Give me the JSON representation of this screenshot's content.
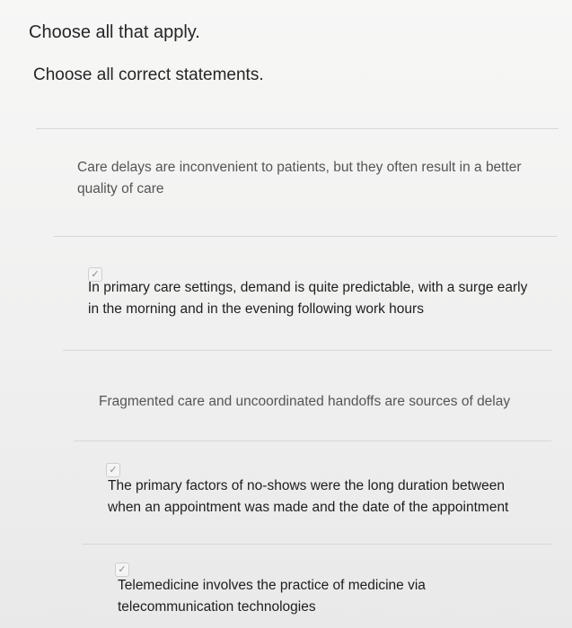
{
  "question": {
    "instruction": "Choose all that apply.",
    "prompt": "Choose all correct statements."
  },
  "options": [
    {
      "text": "Care delays are inconvenient to patients, but they often result in a better quality of care",
      "checked": false
    },
    {
      "text": "In primary care settings, demand is quite predictable, with a surge early in the morning and in the evening following work hours",
      "checked": true
    },
    {
      "text": "Fragmented care and uncoordinated handoffs are sources of delay",
      "checked": false
    },
    {
      "text": "The primary factors of no-shows were the long duration between when an appointment was made and the date of the appointment",
      "checked": true
    },
    {
      "text": "Telemedicine involves the practice of medicine via telecommunication technologies",
      "checked": true
    }
  ],
  "icons": {
    "check": "checkmark-icon"
  }
}
